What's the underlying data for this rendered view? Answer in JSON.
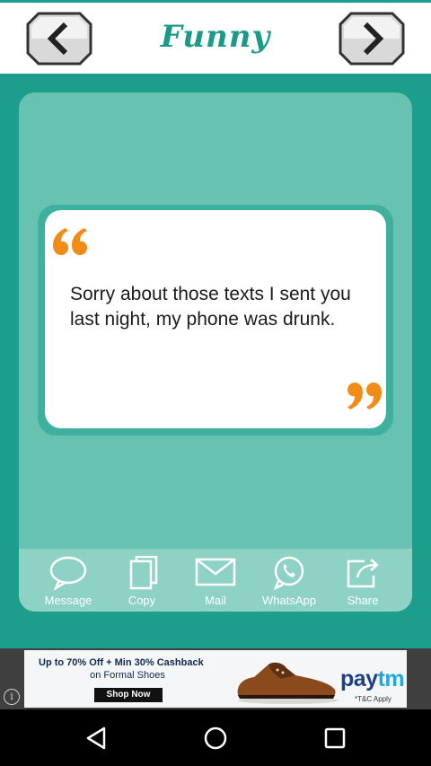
{
  "header": {
    "title": "Funny",
    "prev_icon": "chevron-left-icon",
    "next_icon": "chevron-right-icon"
  },
  "quote": {
    "text": "Sorry about those texts I sent you last night, my phone was drunk.",
    "open_mark_color": "#f28b17",
    "close_mark_color": "#f28b17"
  },
  "actions": [
    {
      "label": "Message",
      "icon": "chat-bubble-icon"
    },
    {
      "label": "Copy",
      "icon": "copy-icon"
    },
    {
      "label": "Mail",
      "icon": "mail-icon"
    },
    {
      "label": "WhatsApp",
      "icon": "whatsapp-icon"
    },
    {
      "label": "Share",
      "icon": "share-icon"
    }
  ],
  "ad": {
    "headline": "Up to 70% Off + Min 30% Cashback",
    "subline": "on Formal Shoes",
    "cta": "Shop Now",
    "brand_a": "pay",
    "brand_b": "tm",
    "terms": "*T&C Apply"
  },
  "colors": {
    "background": "#1d9e8c",
    "card": "#67c2b2",
    "accent": "#f28b17"
  }
}
